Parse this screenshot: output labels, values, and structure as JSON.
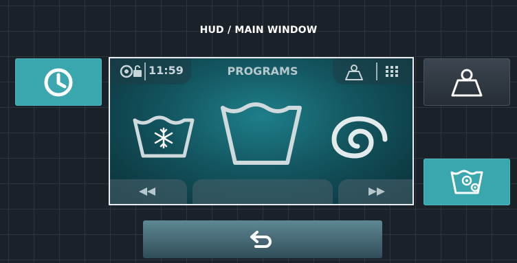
{
  "header": {
    "title": "HUD / MAIN WINDOW"
  },
  "left_panel": {
    "timer_button_icon": "clock-icon"
  },
  "right_panel": {
    "weight_button_icon": "weight-icon",
    "settings_button_icon": "wash-settings-icon"
  },
  "screen": {
    "status_icon": "lock-key-icon",
    "time": "11:59",
    "title": "PROGRAMS",
    "right_icons": [
      "weight-icon",
      "grid-menu-icon"
    ],
    "programs": [
      {
        "icon": "cold-wash-icon"
      },
      {
        "icon": "wash-tub-icon"
      },
      {
        "icon": "spin-icon"
      }
    ],
    "nav": {
      "prev_icon": "rewind-icon",
      "next_icon": "fast-forward-icon"
    }
  },
  "footer": {
    "back_icon": "return-arrow-icon"
  },
  "colors": {
    "accent": "#3aa7ae",
    "background": "#1b2128",
    "screen": "#13555f"
  }
}
